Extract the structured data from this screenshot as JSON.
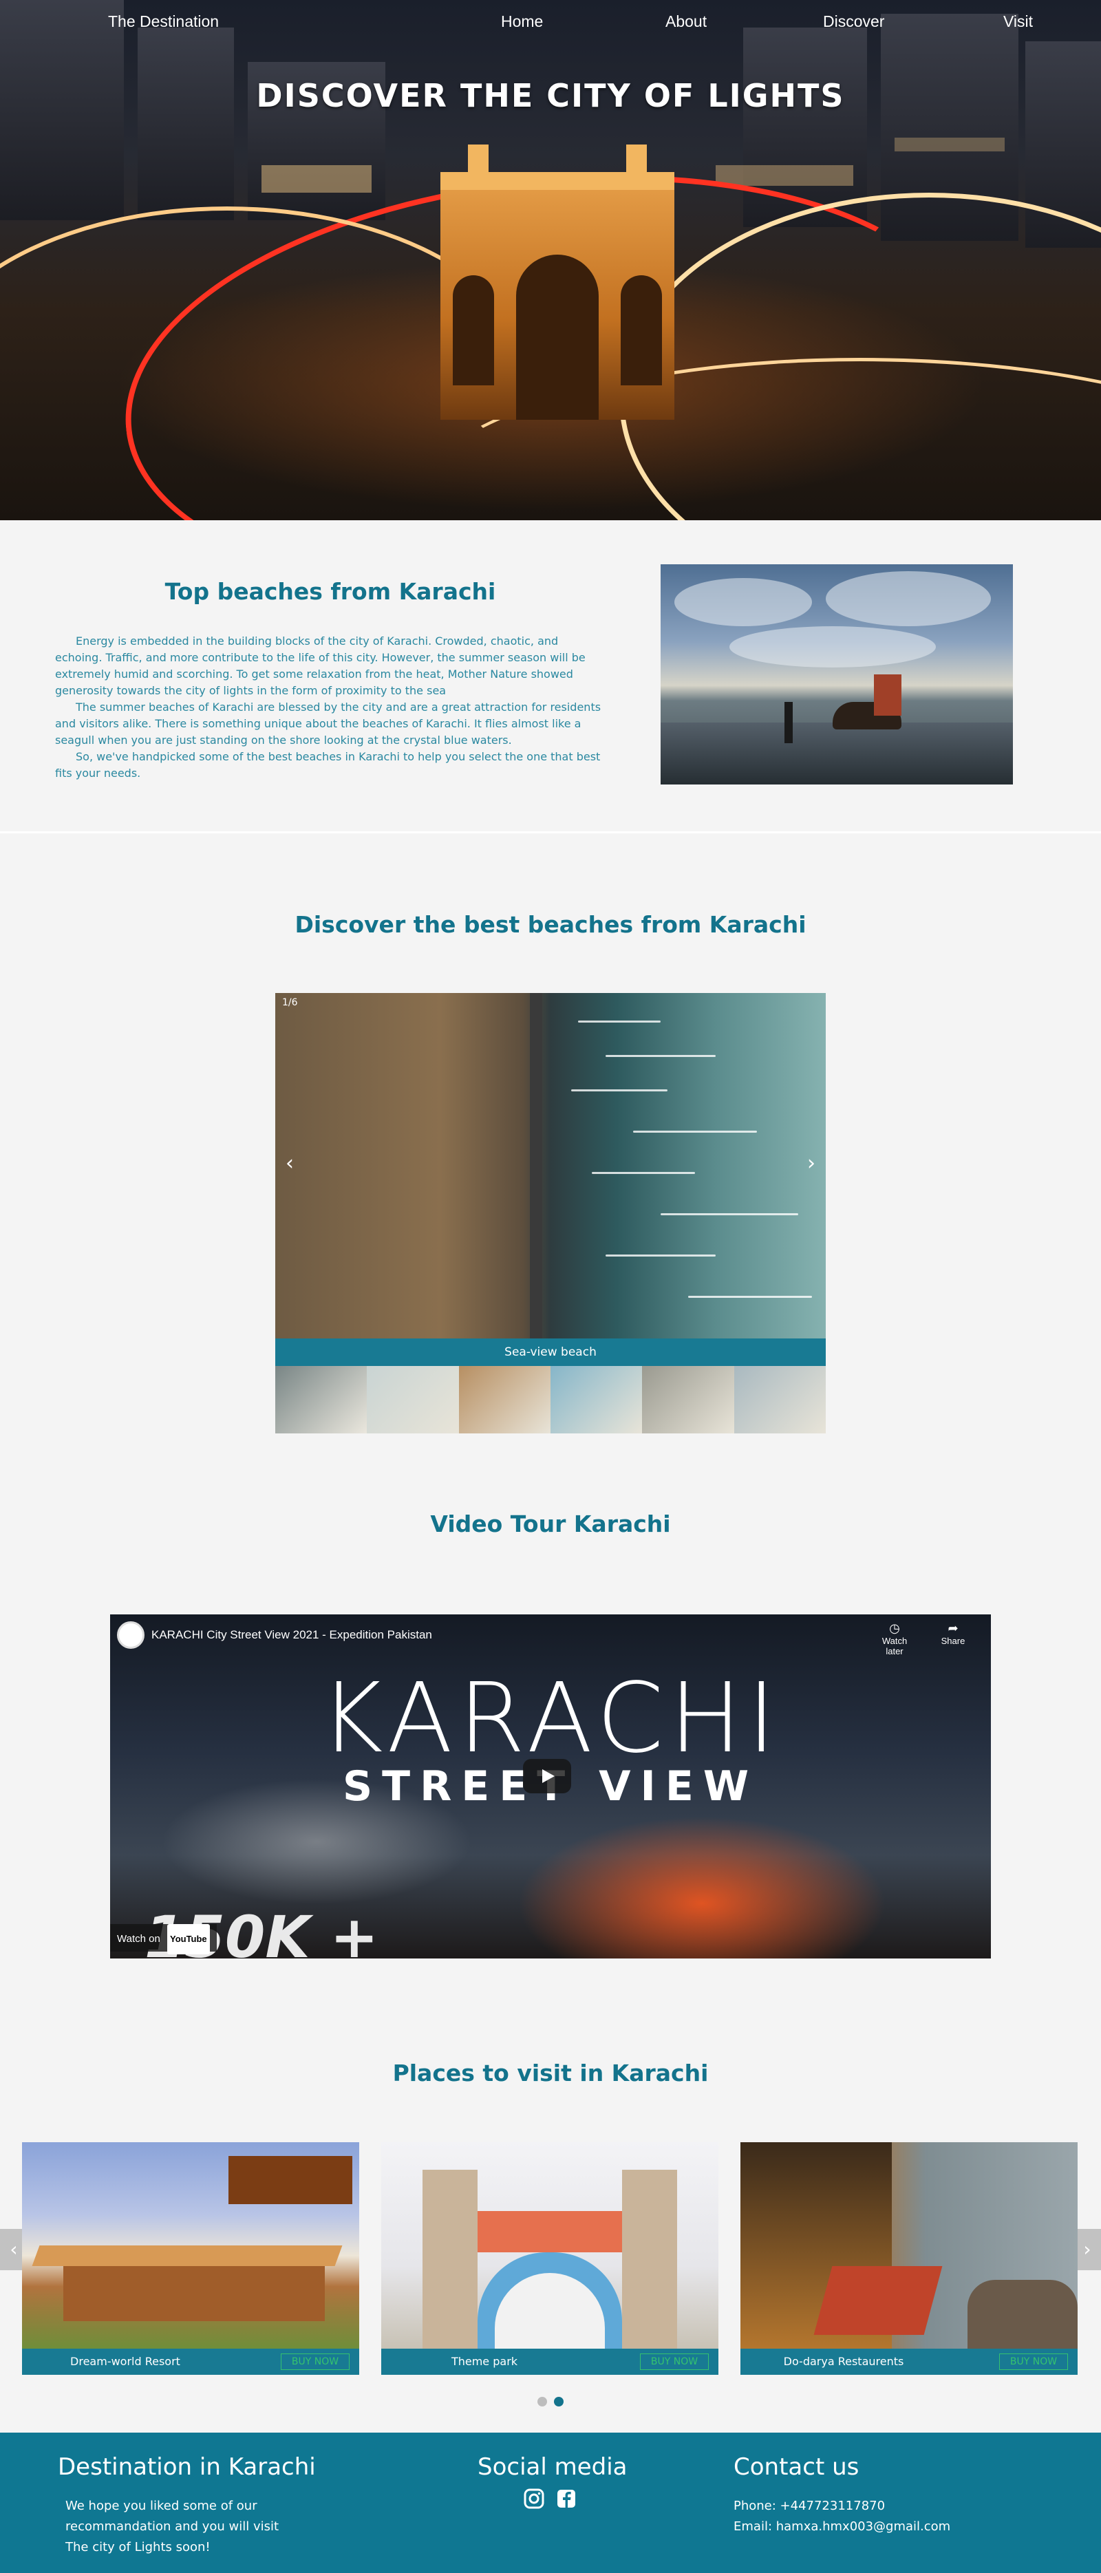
{
  "nav": {
    "brand": "The Destination",
    "links": [
      "Home",
      "About",
      "Discover",
      "Visit"
    ]
  },
  "hero": {
    "title": "DISCOVER THE CITY OF LIGHTS"
  },
  "top_beaches": {
    "title": "Top beaches from Karachi",
    "paragraphs": [
      "Energy is embedded in the building blocks of the city of Karachi. Crowded, chaotic, and echoing. Traffic, and more contribute to the life of this city. However, the summer season will be extremely humid and scorching. To get some relaxation from the heat, Mother Nature showed generosity towards the city of lights in the form of proximity to the sea",
      "The summer beaches of Karachi are blessed by the city and are a great attraction for residents and visitors alike. There is something unique about the beaches of Karachi. It flies almost like a seagull when you are just standing on the shore looking at the crystal blue waters.",
      "So, we've handpicked some of the best beaches in Karachi to help you select the one that best fits your needs."
    ]
  },
  "discover": {
    "title": "Discover the best beaches from Karachi",
    "counter": "1/6",
    "caption": "Sea-view beach",
    "prev_icon": "chevron-left-icon",
    "next_icon": "chevron-right-icon",
    "thumbnail_colors": [
      "#5a6a6a",
      "#c9d4d3",
      "#b78f62",
      "#86b6c9",
      "#9a9a90",
      "#a9b9c0"
    ]
  },
  "video": {
    "section_title": "Video Tour Karachi",
    "title": "KARACHI City Street View 2021 - Expedition Pakistan",
    "big_line1": "KARACHI",
    "big_line2": "STREET VIEW",
    "big_count": "150K +",
    "watch_later": "Watch later",
    "share": "Share",
    "watch_on": "Watch on",
    "youtube": "YouTube"
  },
  "places": {
    "title": "Places to visit in Karachi",
    "buy_label": "BUY NOW",
    "items": [
      {
        "name": "Dream-world Resort"
      },
      {
        "name": "Theme park"
      },
      {
        "name": "Do-darya Restaurents"
      }
    ],
    "prev_icon": "chevron-left-icon",
    "next_icon": "chevron-right-icon"
  },
  "footer": {
    "dest_title": "Destination in Karachi",
    "dest_lines": [
      "We hope you liked some of our",
      "recommandation and you will visit",
      "The city of Lights soon!"
    ],
    "social_title": "Social media",
    "social_icons": [
      "instagram-icon",
      "facebook-icon"
    ],
    "contact_title": "Contact us",
    "phone": "Phone: +447723117870",
    "email": "Email: hamxa.hmx003@gmail.com"
  },
  "colors": {
    "accent": "#13738c",
    "footer_bg": "#0f7792",
    "buy_green": "#35c26f"
  }
}
